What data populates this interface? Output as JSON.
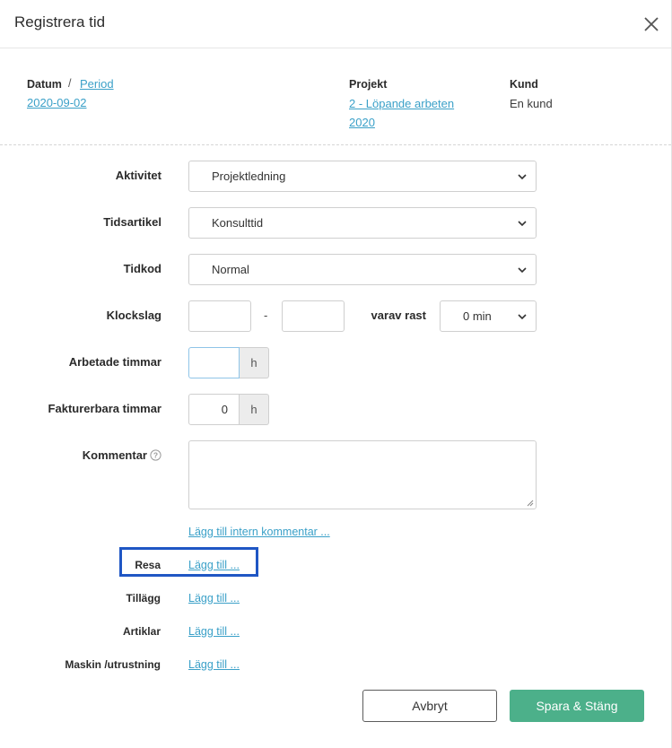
{
  "header": {
    "title": "Registrera tid"
  },
  "info": {
    "date_label": "Datum",
    "separator": "/",
    "period_link": "Period",
    "date_value": "2020-09-02",
    "project_label": "Projekt",
    "project_line1": "2 - Löpande arbeten",
    "project_line2": "2020",
    "customer_label": "Kund",
    "customer_value": "En kund"
  },
  "form": {
    "activity": {
      "label": "Aktivitet",
      "value": "Projektledning"
    },
    "time_article": {
      "label": "Tidsartikel",
      "value": "Konsulttid"
    },
    "time_code": {
      "label": "Tidkod",
      "value": "Normal"
    },
    "clock": {
      "label": "Klockslag",
      "from": "",
      "dash": "-",
      "to": "",
      "break_label": "varav rast",
      "break_value": "0 min"
    },
    "worked_hours": {
      "label": "Arbetade timmar",
      "value": "",
      "unit": "h"
    },
    "billable_hours": {
      "label": "Fakturerbara timmar",
      "value": "0",
      "unit": "h"
    },
    "comment": {
      "label": "Kommentar",
      "value": ""
    },
    "internal_comment_link": "Lägg till intern kommentar ..."
  },
  "extras": [
    {
      "label": "Resa",
      "link": "Lägg till ..."
    },
    {
      "label": "Tillägg",
      "link": "Lägg till ..."
    },
    {
      "label": "Artiklar",
      "link": "Lägg till ..."
    },
    {
      "label": "Maskin /utrustning",
      "link": "Lägg till ..."
    }
  ],
  "buttons": {
    "cancel": "Avbryt",
    "save": "Spara & Stäng"
  },
  "colors": {
    "link": "#3aa0c8",
    "save_button": "#4cb08a",
    "highlight": "#1f56c4"
  }
}
